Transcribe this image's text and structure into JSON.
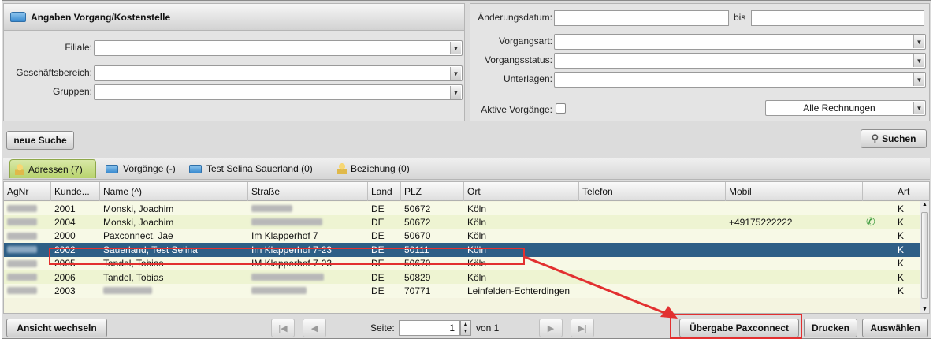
{
  "left_panel": {
    "title": "Angaben Vorgang/Kostenstelle",
    "filiale_label": "Filiale:",
    "geschaeftsbereich_label": "Geschäftsbereich:",
    "gruppen_label": "Gruppen:"
  },
  "right_panel": {
    "aenderungsdatum_label": "Änderungsdatum:",
    "bis_label": "bis",
    "vorgangsart_label": "Vorgangsart:",
    "vorgangsstatus_label": "Vorgangsstatus:",
    "unterlagen_label": "Unterlagen:",
    "aktive_label": "Aktive Vorgänge:",
    "rechnungen_value": "Alle Rechnungen"
  },
  "toolbar": {
    "neue_suche": "neue Suche",
    "suchen": "Suchen"
  },
  "tabs": [
    {
      "label": "Adressen (7)"
    },
    {
      "label": "Vorgänge (-)"
    },
    {
      "label": "Test Selina Sauerland (0)"
    },
    {
      "label": "Beziehung (0)"
    }
  ],
  "table": {
    "columns": [
      "AgNr",
      "Kunde...",
      "Name (^)",
      "Straße",
      "Land",
      "PLZ",
      "Ort",
      "Telefon",
      "Mobil",
      "Art"
    ],
    "rows": [
      {
        "kunde": "2001",
        "name": "Monski, Joachim",
        "strasse": "",
        "land": "DE",
        "plz": "50672",
        "ort": "Köln",
        "telefon": "",
        "mobil": "",
        "art": "K"
      },
      {
        "kunde": "2004",
        "name": "Monski, Joachim",
        "strasse": "",
        "land": "DE",
        "plz": "50672",
        "ort": "Köln",
        "telefon": "",
        "mobil": "+49175222222",
        "art": "K"
      },
      {
        "kunde": "2000",
        "name": "Paxconnect, Jae",
        "strasse": "Im Klapperhof 7",
        "land": "DE",
        "plz": "50670",
        "ort": "Köln",
        "telefon": "",
        "mobil": "",
        "art": "K"
      },
      {
        "kunde": "2002",
        "name": "Sauerland, Test Selina",
        "strasse": "Im Klapperhof 7-23",
        "land": "DE",
        "plz": "50111",
        "ort": "Köln",
        "telefon": "",
        "mobil": "",
        "art": "K"
      },
      {
        "kunde": "2005",
        "name": "Tandel, Tobias",
        "strasse": "IM Klapperhof 7-23",
        "land": "DE",
        "plz": "50670",
        "ort": "Köln",
        "telefon": "",
        "mobil": "",
        "art": "K"
      },
      {
        "kunde": "2006",
        "name": "Tandel, Tobias",
        "strasse": "",
        "land": "DE",
        "plz": "50829",
        "ort": "Köln",
        "telefon": "",
        "mobil": "",
        "art": "K"
      },
      {
        "kunde": "2003",
        "name": "",
        "strasse": "",
        "land": "DE",
        "plz": "70771",
        "ort": "Leinfelden-Echterdingen",
        "telefon": "",
        "mobil": "",
        "art": "K"
      }
    ]
  },
  "bottom": {
    "ansicht_wechseln": "Ansicht wechseln",
    "seite_label": "Seite:",
    "page_value": "1",
    "von_label": "von 1",
    "uebergabe": "Übergabe Paxconnect",
    "drucken": "Drucken",
    "auswaehlen": "Auswählen"
  },
  "colors": {
    "selected_row": "#2e5f86",
    "row_even": "#eef4d2",
    "row_odd": "#f7f9e6",
    "annotation": "#e23030"
  }
}
